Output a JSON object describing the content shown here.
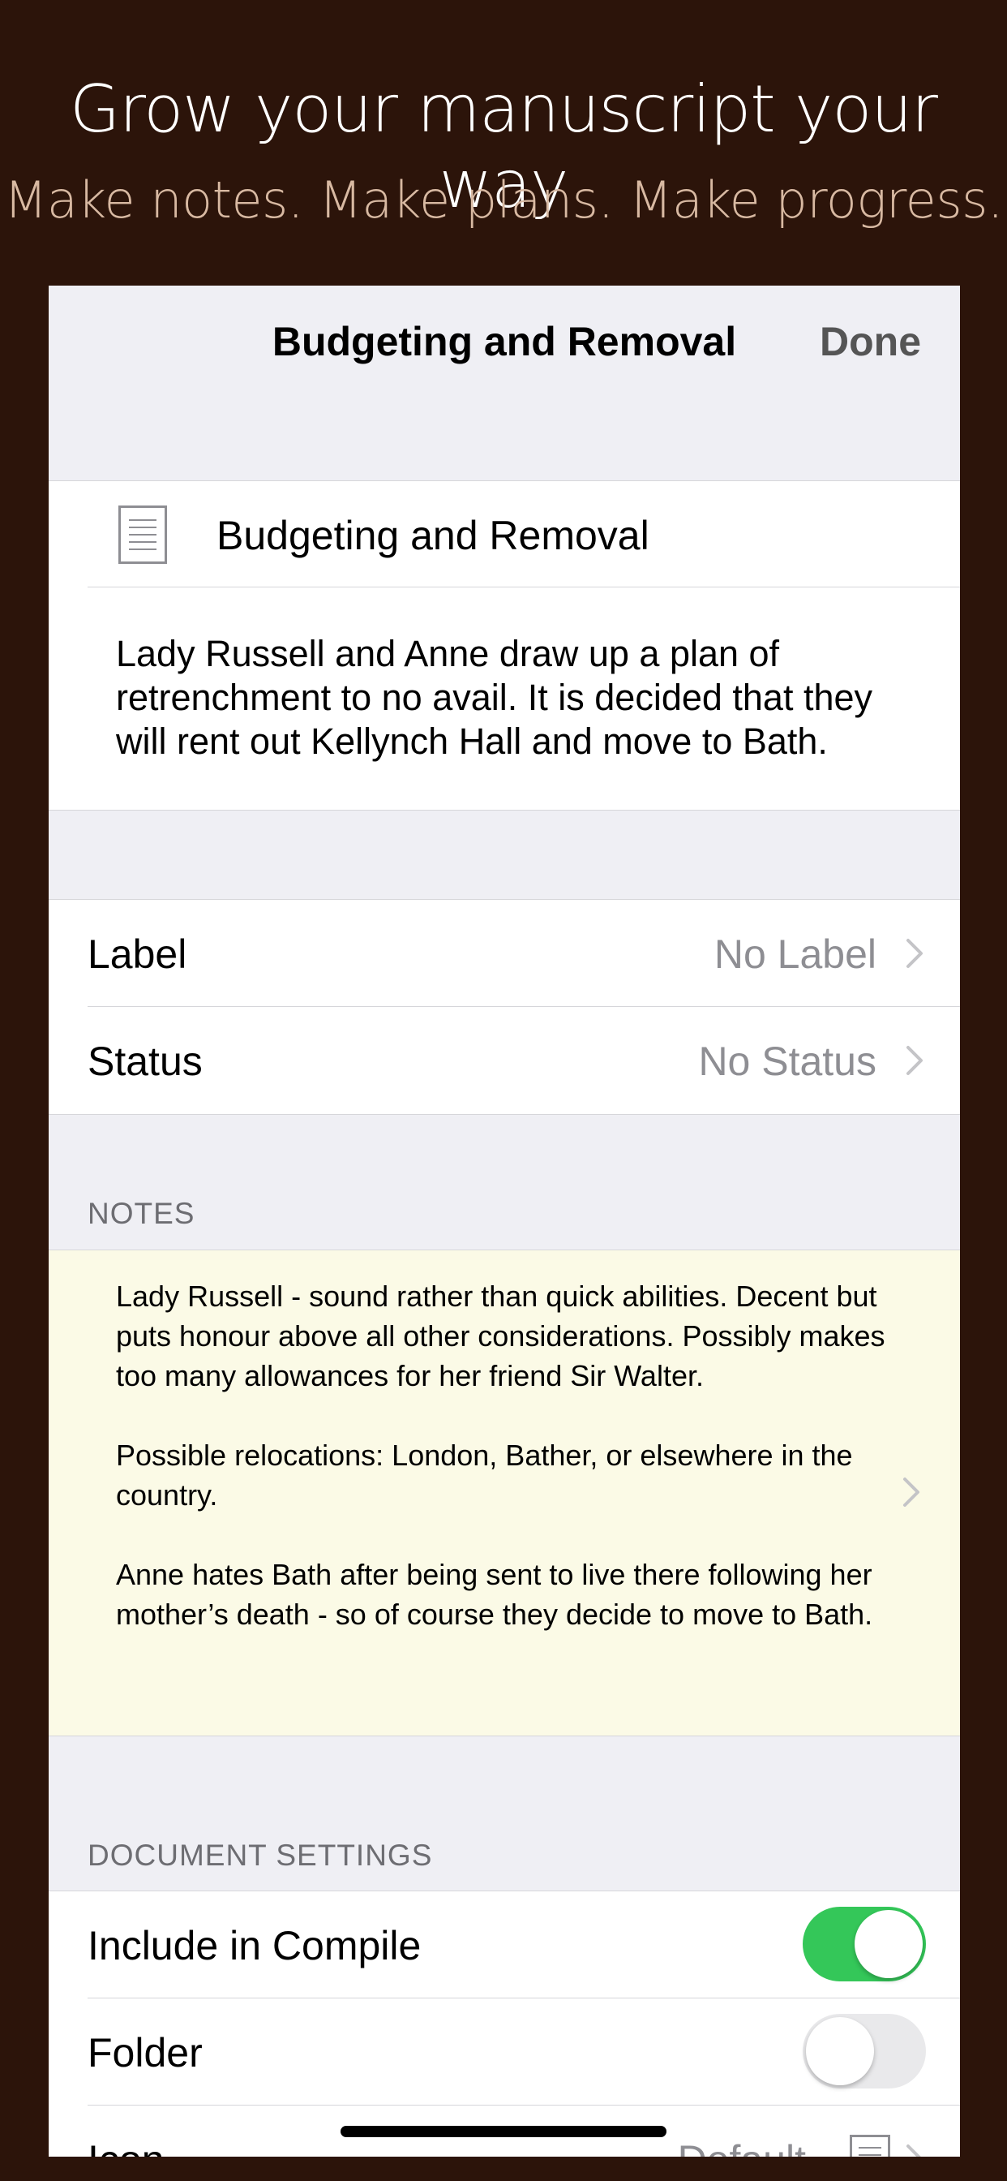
{
  "promo": {
    "title": "Grow your manuscript your way",
    "subtitle": "Make notes. Make plans. Make progress."
  },
  "navbar": {
    "title": "Budgeting and Removal",
    "done_label": "Done"
  },
  "document": {
    "icon": "document-icon",
    "title": "Budgeting and Removal",
    "synopsis": "Lady Russell and Anne draw up a plan of retrenchment to no avail. It is decided that they will rent out Kellynch Hall and move to Bath."
  },
  "metadata": {
    "label": {
      "name": "Label",
      "value": "No Label"
    },
    "status": {
      "name": "Status",
      "value": "No Status"
    }
  },
  "notes": {
    "header": "NOTES",
    "paragraphs": [
      "Lady Russell - sound rather than quick abilities. Decent but puts honour above all other considerations. Possibly makes too many allowances for her friend Sir Walter.",
      "Possible relocations: London, Bather, or elsewhere in the country.",
      "Anne hates Bath after being sent to live there following her mother’s death - so of course they decide to move to Bath."
    ]
  },
  "document_settings": {
    "header": "DOCUMENT SETTINGS",
    "include_in_compile": {
      "label": "Include in Compile",
      "on": true
    },
    "folder": {
      "label": "Folder",
      "on": false
    },
    "icon_row": {
      "label": "Icon",
      "value": "Default"
    }
  },
  "colors": {
    "background": "#2c140a",
    "accent_toggle_on": "#34c759",
    "notes_background": "#fbfae6"
  }
}
